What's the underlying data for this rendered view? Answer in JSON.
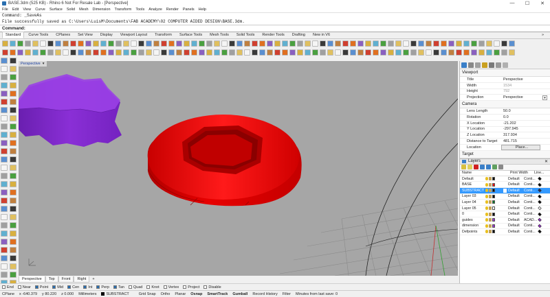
{
  "window": {
    "title": "BASE.3dm (525 KB) - Rhino 6 Not For Resale Lab - [Perspective]",
    "controls": [
      "—",
      "☐",
      "✕"
    ]
  },
  "menu": [
    "File",
    "Edit",
    "View",
    "Curve",
    "Surface",
    "Solid",
    "Mesh",
    "Dimension",
    "Transform",
    "Tools",
    "Analyze",
    "Render",
    "Panels",
    "Help"
  ],
  "command_history": [
    "Command: _SaveAs",
    "File successfully saved as C:\\Users\\LuisM\\Documents\\FAB ACADEMY\\02 COMPUTER AIDED DESIGN\\BASE.3dm."
  ],
  "command_prompt": {
    "label": "Command:",
    "value": ""
  },
  "toolbar_tabs": [
    "Standard",
    "Curve Tools",
    "CPlanes",
    "Set View",
    "Display",
    "Viewport Layout",
    "Transform",
    "Surface Tools",
    "Mesh Tools",
    "Solid Tools",
    "Render Tools",
    "Drafting",
    "New in V6"
  ],
  "toolbar_tabs_active": "Standard",
  "toolbar_tabs_overflow": "»",
  "viewport": {
    "title": "Perspective",
    "dropdown": "▾"
  },
  "viewport_tabs": [
    "Perspective",
    "Top",
    "Front",
    "Right"
  ],
  "viewport_tabs_add": "+",
  "osnaps": [
    {
      "label": "End",
      "on": false
    },
    {
      "label": "Near",
      "on": false
    },
    {
      "label": "Point",
      "on": true
    },
    {
      "label": "Mid",
      "on": true
    },
    {
      "label": "Cen",
      "on": true
    },
    {
      "label": "Int",
      "on": true
    },
    {
      "label": "Perp",
      "on": true
    },
    {
      "label": "Tan",
      "on": true
    },
    {
      "label": "Quad",
      "on": false
    },
    {
      "label": "Knot",
      "on": false
    },
    {
      "label": "Vertex",
      "on": false
    },
    {
      "label": "Project",
      "on": false
    },
    {
      "label": "Disable",
      "on": false
    }
  ],
  "status": {
    "cplane": "CPlane",
    "x": "x -640.379",
    "y": "y 80.220",
    "z": "z 0.000",
    "units": "Millimeters",
    "layer": "SUBSTRACT",
    "toggles": [
      "Grid Snap",
      "Ortho",
      "Planar",
      "Osnap",
      "SmartTrack",
      "Gumball",
      "Record History",
      "Filter"
    ],
    "toggles_bold": [
      "Osnap",
      "SmartTrack",
      "Gumball"
    ],
    "save_msg": "Minutes from last save: 0"
  },
  "properties": {
    "viewport_section": "Viewport",
    "viewport_rows": [
      {
        "k": "Title",
        "v": "Perspective",
        "dim": false
      },
      {
        "k": "Width",
        "v": "1534",
        "dim": true
      },
      {
        "k": "Height",
        "v": "792",
        "dim": true
      },
      {
        "k": "Projection",
        "v": "Perspective",
        "dim": false
      }
    ],
    "camera_section": "Camera",
    "camera_rows": [
      {
        "k": "Lens Length",
        "v": "50.0"
      },
      {
        "k": "Rotation",
        "v": "0.0"
      },
      {
        "k": "X Location",
        "v": "-21.202"
      },
      {
        "k": "Y Location",
        "v": "-297.945"
      },
      {
        "k": "Z Location",
        "v": "317.934"
      },
      {
        "k": "Distance to Target",
        "v": "481.715"
      }
    ],
    "location_label": "Location",
    "location_button": "Place...",
    "target_section": "Target"
  },
  "layers": {
    "title": "Layers",
    "close": "✕",
    "columns": {
      "name": "Name",
      "print_width": "Print Width",
      "linetype": "Line..."
    },
    "rows": [
      {
        "name": "Default",
        "color": "#000000",
        "material": "Default",
        "linetype": "Conti...",
        "print_color": "#000000",
        "selected": false
      },
      {
        "name": "BASE",
        "color": "#ff0000",
        "material": "Default",
        "linetype": "Conti...",
        "print_color": "#000000",
        "selected": false
      },
      {
        "name": "SUBSTRACT",
        "color": "#000000",
        "material": "Default",
        "linetype": "Conti...",
        "print_color": "#1d2b5e",
        "selected": true
      },
      {
        "name": "Layer 03",
        "color": "#000000",
        "material": "Default",
        "linetype": "Conti...",
        "print_color": "#000000",
        "selected": false
      },
      {
        "name": "Layer 04",
        "color": "#0a7a30",
        "material": "Default",
        "linetype": "Conti...",
        "print_color": "#000000",
        "selected": false
      },
      {
        "name": "Layer 05",
        "color": "#ffffff",
        "material": "Default",
        "linetype": "Conti...",
        "print_color": "#ffffff",
        "selected": false
      },
      {
        "name": "0",
        "color": "#000000",
        "material": "Default",
        "linetype": "Conti...",
        "print_color": "#000000",
        "selected": false
      },
      {
        "name": "guides",
        "color": "#9b30d0",
        "material": "Default",
        "linetype": "ACAD...",
        "print_color": "#9b30d0",
        "selected": false
      },
      {
        "name": "dimension",
        "color": "#9b30d0",
        "material": "Default",
        "linetype": "Conti...",
        "print_color": "#9b30d0",
        "selected": false
      },
      {
        "name": "Defpoints",
        "color": "#000000",
        "material": "Default",
        "linetype": "Conti...",
        "print_color": "#000000",
        "selected": false
      }
    ]
  },
  "colors": {
    "viewport_bg": "#a6a6a6",
    "cap_purple": "#8a2fd6",
    "base_red": "#e00000",
    "selection": "#3399ff",
    "accent_blue": "#1a3fa0"
  }
}
